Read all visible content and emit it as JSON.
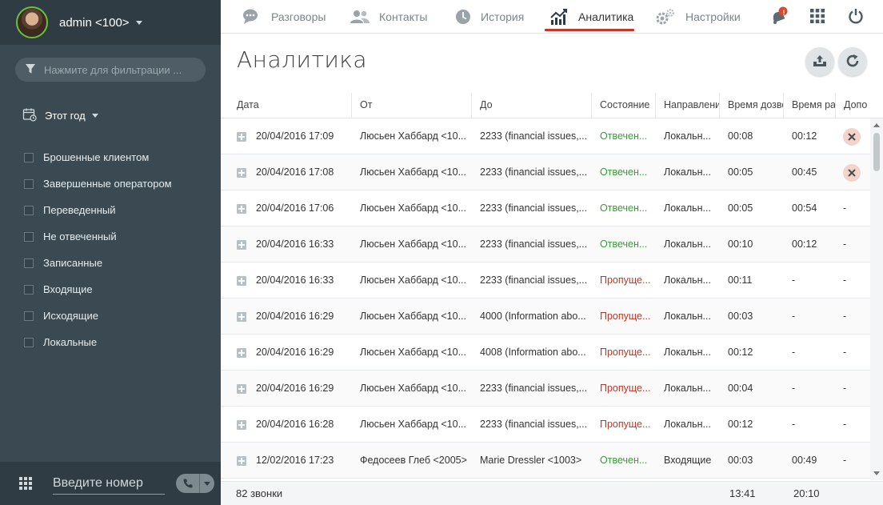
{
  "user": {
    "name": "admin <100>"
  },
  "sidebar": {
    "filter_placeholder": "Нажмите для фильтрации ...",
    "period_label": "Этот год",
    "filters": [
      "Брошенные клиентом",
      "Завершенные оператором",
      "Переведенный",
      "Не отвеченный",
      "Записанные",
      "Входящие",
      "Исходящие",
      "Локальные"
    ],
    "dial_placeholder": "Введите номер"
  },
  "nav": {
    "items": [
      {
        "label": "Разговоры",
        "icon": "chat-icon"
      },
      {
        "label": "Контакты",
        "icon": "contacts-icon"
      },
      {
        "label": "История",
        "icon": "history-clock-icon"
      },
      {
        "label": "Аналитика",
        "icon": "analytics-chart-icon",
        "active": true
      },
      {
        "label": "Настройки",
        "icon": "settings-gears-icon"
      }
    ],
    "notification_badge": "!",
    "accent_color": "#c0392b"
  },
  "page": {
    "title": "Аналитика"
  },
  "table": {
    "columns": [
      "Дата",
      "От",
      "До",
      "Состояние",
      "Направлени",
      "Время дозво",
      "Время ра",
      "Допо"
    ],
    "rows": [
      {
        "date": "20/04/2016 17:09",
        "from": "Люсьен Хаббард <10...",
        "to": "2233 (financial issues,...",
        "status": "Отвечен...",
        "status_type": "answered",
        "direction": "Локальн...",
        "ring": "00:08",
        "talk": "00:12",
        "extra": "delete"
      },
      {
        "date": "20/04/2016 17:08",
        "from": "Люсьен Хаббард <10...",
        "to": "2233 (financial issues,...",
        "status": "Отвечен...",
        "status_type": "answered",
        "direction": "Локальн...",
        "ring": "00:05",
        "talk": "00:45",
        "extra": "delete"
      },
      {
        "date": "20/04/2016 17:06",
        "from": "Люсьен Хаббард <10...",
        "to": "2233 (financial issues,...",
        "status": "Отвечен...",
        "status_type": "answered",
        "direction": "Локальн...",
        "ring": "00:05",
        "talk": "00:54",
        "extra": "-"
      },
      {
        "date": "20/04/2016 16:33",
        "from": "Люсьен Хаббард <10...",
        "to": "2233 (financial issues,...",
        "status": "Отвечен...",
        "status_type": "answered",
        "direction": "Локальн...",
        "ring": "00:10",
        "talk": "00:12",
        "extra": "-"
      },
      {
        "date": "20/04/2016 16:33",
        "from": "Люсьен Хаббард <10...",
        "to": "2233 (financial issues,...",
        "status": "Пропуще...",
        "status_type": "missed",
        "direction": "Локальн...",
        "ring": "00:11",
        "talk": "-",
        "extra": "-"
      },
      {
        "date": "20/04/2016 16:29",
        "from": "Люсьен Хаббард <10...",
        "to": "4000 (Information abo...",
        "status": "Пропуще...",
        "status_type": "missed",
        "direction": "Локальн...",
        "ring": "00:03",
        "talk": "-",
        "extra": "-"
      },
      {
        "date": "20/04/2016 16:29",
        "from": "Люсьен Хаббард <10...",
        "to": "4008 (Information abo...",
        "status": "Пропуще...",
        "status_type": "missed",
        "direction": "Локальн...",
        "ring": "00:12",
        "talk": "-",
        "extra": "-"
      },
      {
        "date": "20/04/2016 16:29",
        "from": "Люсьен Хаббард <10...",
        "to": "2233 (financial issues,...",
        "status": "Пропуще...",
        "status_type": "missed",
        "direction": "Локальн...",
        "ring": "00:04",
        "talk": "-",
        "extra": "-"
      },
      {
        "date": "20/04/2016 16:28",
        "from": "Люсьен Хаббард <10...",
        "to": "2233 (financial issues,...",
        "status": "Пропуще...",
        "status_type": "missed",
        "direction": "Локальн...",
        "ring": "00:12",
        "talk": "-",
        "extra": "-"
      },
      {
        "date": "12/02/2016 17:23",
        "from": "Федосеев Глеб <2005>",
        "to": "Marie Dressler <1003>",
        "status": "Отвечен...",
        "status_type": "answered",
        "direction": "Входящие",
        "ring": "00:03",
        "talk": "00:49",
        "extra": "-"
      }
    ],
    "footer": {
      "count": "82 звонки",
      "ring_total": "13:41",
      "talk_total": "20:10"
    }
  }
}
